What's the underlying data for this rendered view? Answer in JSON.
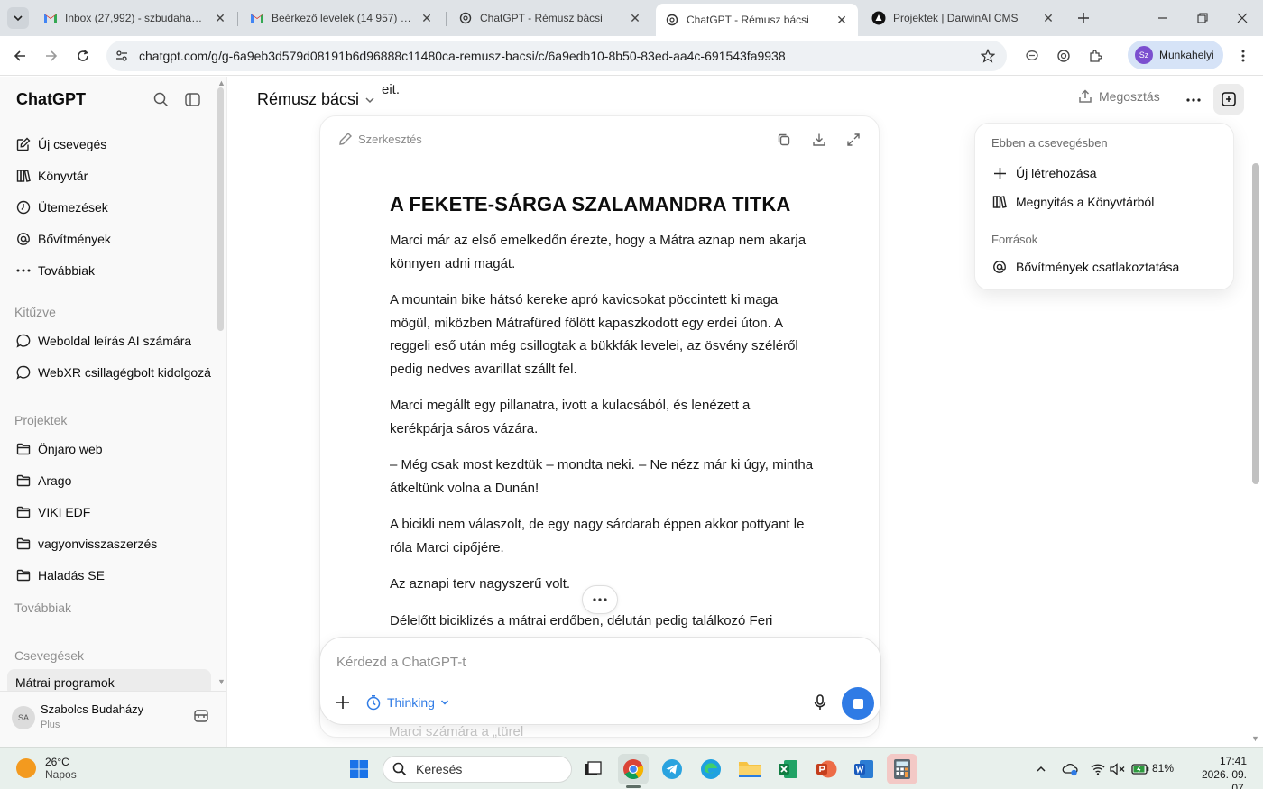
{
  "browser": {
    "tabs": [
      {
        "title": "Inbox (27,992) - szbudahazy@a",
        "icon": "gmail-icon",
        "active": false
      },
      {
        "title": "Beérkező levelek (14 957) - szb",
        "icon": "gmail-icon",
        "active": false
      },
      {
        "title": "ChatGPT - Rémusz bácsi",
        "icon": "chatgpt-icon",
        "active": false
      },
      {
        "title": "ChatGPT - Rémusz bácsi",
        "icon": "chatgpt-icon",
        "active": true
      },
      {
        "title": "Projektek | DarwinAI CMS",
        "icon": "darwinai-icon",
        "active": false
      }
    ],
    "url": "chatgpt.com/g/g-6a9eb3d579d08191b6d96888c11480ca-remusz-bacsi/c/6a9edb10-8b50-83ed-aa4c-691543fa9938",
    "profile": {
      "initials": "Sz",
      "label": "Munkahelyi"
    }
  },
  "sidebar": {
    "brand": "ChatGPT",
    "nav": [
      {
        "label": "Új csevegés",
        "icon": "new-chat-icon"
      },
      {
        "label": "Könyvtár",
        "icon": "library-icon"
      },
      {
        "label": "Ütemezések",
        "icon": "clock-icon"
      },
      {
        "label": "Bővítmények",
        "icon": "at-icon"
      },
      {
        "label": "Továbbiak",
        "icon": "more-icon"
      }
    ],
    "pinned_title": "Kitűzve",
    "pinned": [
      {
        "label": "Weboldal leírás AI számára"
      },
      {
        "label": "WebXR csillagégbolt kidolgozása"
      }
    ],
    "projects_title": "Projektek",
    "projects": [
      {
        "label": "Önjaro web"
      },
      {
        "label": "Arago"
      },
      {
        "label": "VIKI EDF"
      },
      {
        "label": "vagyonvisszaszerzés"
      },
      {
        "label": "Haladás SE"
      }
    ],
    "more_label": "Továbbiak",
    "chats_title": "Csevegések",
    "chats": [
      {
        "label": "Mátrai programok"
      }
    ],
    "user": {
      "initials": "SA",
      "name": "Szabolcs Budaházy",
      "plan": "Plus"
    }
  },
  "main": {
    "gpt_name": "Rémusz bácsi",
    "behind_text": "eit.",
    "share_label": "Megosztás",
    "canvas": {
      "edit_label": "Szerkesztés",
      "title": "A FEKETE-SÁRGA SZALAMANDRA TITKA",
      "paragraphs": [
        "Marci már az első emelkedőn érezte, hogy a Mátra aznap nem akarja könnyen adni magát.",
        "A mountain bike hátsó kereke apró kavicsokat pöccintett ki maga mögül, miközben Mátrafüred fölött kapaszkodott egy erdei úton. A reggeli eső után még csillogtak a bükkfák levelei, az ösvény széléről pedig nedves avarillat szállt fel.",
        "Marci megállt egy pillanatra, ivott a kulacsából, és lenézett a kerékpárja sáros vázára.",
        "– Még csak most kezdtük – mondta neki. – Ne nézz már ki úgy, mintha átkeltünk volna a Dunán!",
        "A bicikli nem válaszolt, de egy nagy sárdarab éppen akkor pottyant le róla Marci cipőjére.",
        "Az aznapi terv nagyszerű volt.",
        "Délelőtt biciklizés a mátrai erdőben, délután pedig találkozó Feri"
      ],
      "under_text": "Marci számára a „türel"
    },
    "composer": {
      "placeholder": "Kérdezd a ChatGPT-t",
      "mode_label": "Thinking"
    },
    "panel": {
      "section1": "Ebben a csevegésben",
      "items1": [
        {
          "label": "Új létrehozása",
          "icon": "plus-icon"
        },
        {
          "label": "Megnyitás a Könyvtárból",
          "icon": "library-icon"
        }
      ],
      "section2": "Források",
      "items2": [
        {
          "label": "Bővítmények csatlakoztatása",
          "icon": "at-icon"
        }
      ]
    }
  },
  "taskbar": {
    "weather_temp": "26°C",
    "weather_desc": "Napos",
    "search_label": "Keresés",
    "battery": "81%",
    "time": "17:41",
    "date": "2026. 09. 07."
  },
  "colors": {
    "accent": "#2f7be5",
    "profile_bg": "#d6e3f7",
    "taskbar_bg": "#e8f0ec"
  }
}
